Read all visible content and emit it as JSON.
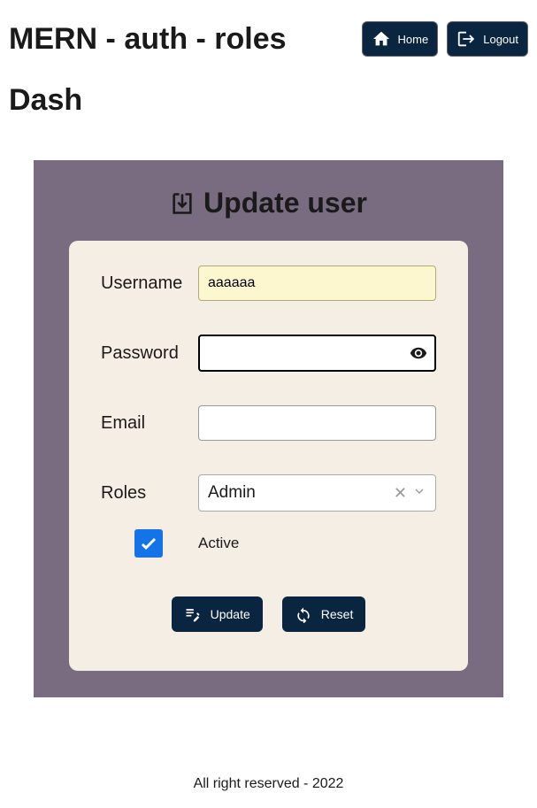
{
  "header": {
    "app_title": "MERN - auth - roles",
    "home_label": "Home",
    "logout_label": "Logout"
  },
  "page": {
    "title": "Dash"
  },
  "panel": {
    "title": "Update user"
  },
  "form": {
    "username_label": "Username",
    "username_value": "aaaaaa",
    "password_label": "Password",
    "password_value": "",
    "email_label": "Email",
    "email_value": "",
    "roles_label": "Roles",
    "roles_selected": "Admin",
    "active_label": "Active",
    "active_checked": true
  },
  "actions": {
    "update_label": "Update",
    "reset_label": "Reset"
  },
  "footer": {
    "text": "All right reserved - 2022"
  }
}
